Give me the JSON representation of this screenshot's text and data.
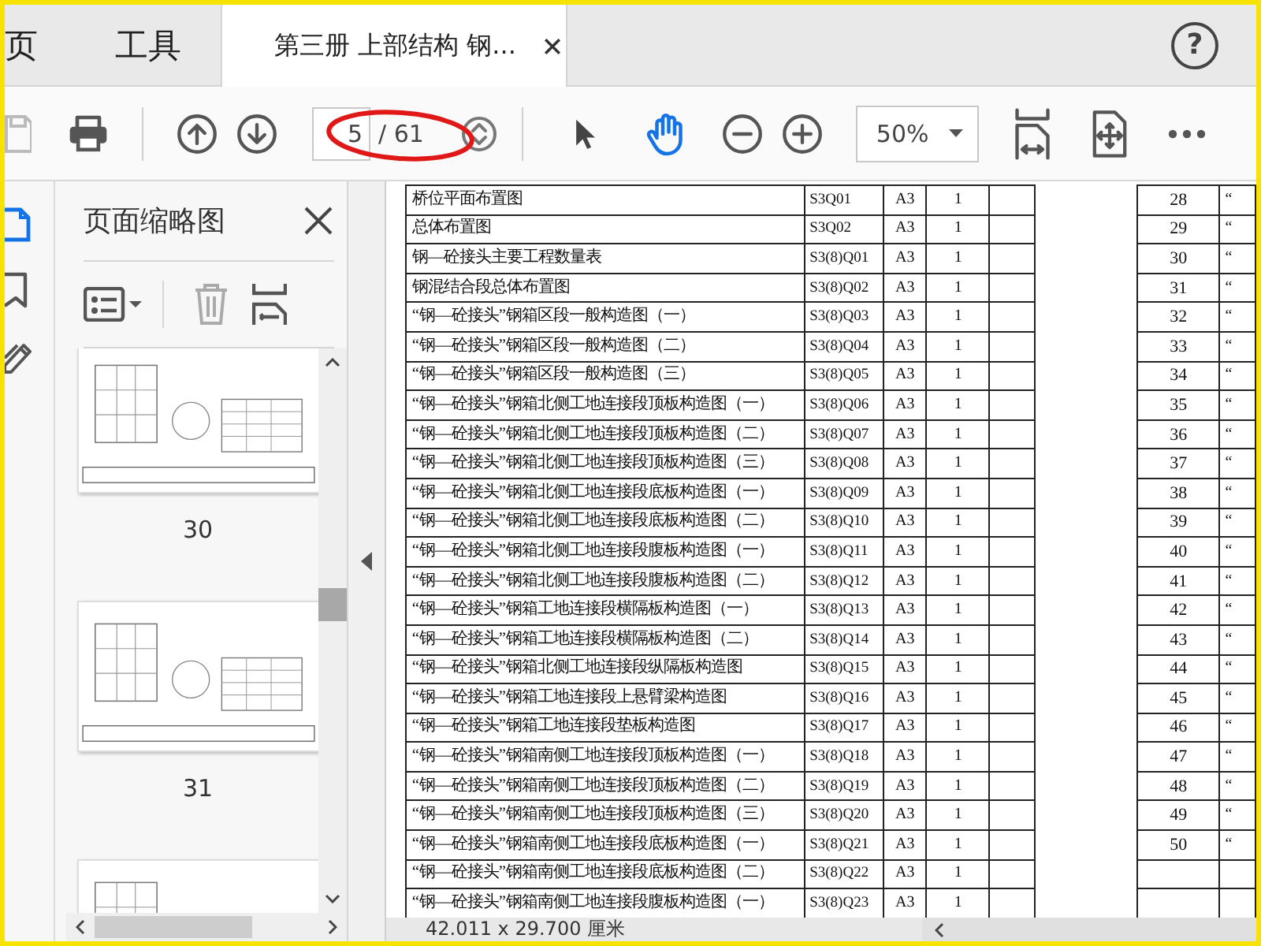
{
  "tabs": [
    {
      "label": "页",
      "selected": false
    },
    {
      "label": "工具",
      "selected": false
    },
    {
      "label": "第三册 上部结构 钢...",
      "selected": true
    }
  ],
  "help_label": "?",
  "toolbar": {
    "page_number": "5",
    "page_total": "/ 61",
    "zoom": "50%",
    "tools": [
      {
        "kind": "select",
        "selected": false
      },
      {
        "kind": "hand",
        "selected": true
      }
    ]
  },
  "side_rail": [
    {
      "kind": "pages",
      "selected": true
    },
    {
      "kind": "bookmarks",
      "selected": false
    },
    {
      "kind": "signatures",
      "selected": false
    }
  ],
  "thumbnail_panel": {
    "title": "页面缩略图",
    "thumbnails": [
      {
        "label": "30",
        "selected": false
      },
      {
        "label": "31",
        "selected": false
      },
      {
        "selected": false
      }
    ]
  },
  "document": {
    "rows": [
      {
        "title": "桥位平面布置图",
        "code": "S3Q01",
        "size": "A3",
        "count": "1",
        "number": "28",
        "column_8": "“"
      },
      {
        "title": "总体布置图",
        "code": "S3Q02",
        "size": "A3",
        "count": "1",
        "number": "29",
        "column_8": "“"
      },
      {
        "title": "钢—砼接头主要工程数量表",
        "code": "S3(8)Q01",
        "size": "A3",
        "count": "1",
        "number": "30",
        "column_8": "“"
      },
      {
        "title": "钢混结合段总体布置图",
        "code": "S3(8)Q02",
        "size": "A3",
        "count": "1",
        "number": "31",
        "column_8": "“"
      },
      {
        "title": "“钢—砼接头”钢箱区段一般构造图（一）",
        "code": "S3(8)Q03",
        "size": "A3",
        "count": "1",
        "number": "32",
        "column_8": "“"
      },
      {
        "title": "“钢—砼接头”钢箱区段一般构造图（二）",
        "code": "S3(8)Q04",
        "size": "A3",
        "count": "1",
        "number": "33",
        "column_8": "“"
      },
      {
        "title": "“钢—砼接头”钢箱区段一般构造图（三）",
        "code": "S3(8)Q05",
        "size": "A3",
        "count": "1",
        "number": "34",
        "column_8": "“"
      },
      {
        "title": "“钢—砼接头”钢箱北侧工地连接段顶板构造图（一）",
        "code": "S3(8)Q06",
        "size": "A3",
        "count": "1",
        "number": "35",
        "column_8": "“"
      },
      {
        "title": "“钢—砼接头”钢箱北侧工地连接段顶板构造图（二）",
        "code": "S3(8)Q07",
        "size": "A3",
        "count": "1",
        "number": "36",
        "column_8": "“"
      },
      {
        "title": "“钢—砼接头”钢箱北侧工地连接段顶板构造图（三）",
        "code": "S3(8)Q08",
        "size": "A3",
        "count": "1",
        "number": "37",
        "column_8": "“"
      },
      {
        "title": "“钢—砼接头”钢箱北侧工地连接段底板构造图（一）",
        "code": "S3(8)Q09",
        "size": "A3",
        "count": "1",
        "number": "38",
        "column_8": "“"
      },
      {
        "title": "“钢—砼接头”钢箱北侧工地连接段底板构造图（二）",
        "code": "S3(8)Q10",
        "size": "A3",
        "count": "1",
        "number": "39",
        "column_8": "“"
      },
      {
        "title": "“钢—砼接头”钢箱北侧工地连接段腹板构造图（一）",
        "code": "S3(8)Q11",
        "size": "A3",
        "count": "1",
        "number": "40",
        "column_8": "“"
      },
      {
        "title": "“钢—砼接头”钢箱北侧工地连接段腹板构造图（二）",
        "code": "S3(8)Q12",
        "size": "A3",
        "count": "1",
        "number": "41",
        "column_8": "“"
      },
      {
        "title": "“钢—砼接头”钢箱工地连接段横隔板构造图（一）",
        "code": "S3(8)Q13",
        "size": "A3",
        "count": "1",
        "number": "42",
        "column_8": "“"
      },
      {
        "title": "“钢—砼接头”钢箱工地连接段横隔板构造图（二）",
        "code": "S3(8)Q14",
        "size": "A3",
        "count": "1",
        "number": "43",
        "column_8": "“"
      },
      {
        "title": "“钢—砼接头”钢箱北侧工地连接段纵隔板构造图",
        "code": "S3(8)Q15",
        "size": "A3",
        "count": "1",
        "number": "44",
        "column_8": "“"
      },
      {
        "title": "“钢—砼接头”钢箱工地连接段上悬臂梁构造图",
        "code": "S3(8)Q16",
        "size": "A3",
        "count": "1",
        "number": "45",
        "column_8": "“"
      },
      {
        "title": "“钢—砼接头”钢箱工地连接段垫板构造图",
        "code": "S3(8)Q17",
        "size": "A3",
        "count": "1",
        "number": "46",
        "column_8": "“"
      },
      {
        "title": "“钢—砼接头”钢箱南侧工地连接段顶板构造图（一）",
        "code": "S3(8)Q18",
        "size": "A3",
        "count": "1",
        "number": "47",
        "column_8": "“"
      },
      {
        "title": "“钢—砼接头”钢箱南侧工地连接段顶板构造图（二）",
        "code": "S3(8)Q19",
        "size": "A3",
        "count": "1",
        "number": "48",
        "column_8": "“"
      },
      {
        "title": "“钢—砼接头”钢箱南侧工地连接段顶板构造图（三）",
        "code": "S3(8)Q20",
        "size": "A3",
        "count": "1",
        "number": "49",
        "column_8": "“"
      },
      {
        "title": "“钢—砼接头”钢箱南侧工地连接段底板构造图（一）",
        "code": "S3(8)Q21",
        "size": "A3",
        "count": "1",
        "number": "50",
        "column_8": "“"
      },
      {
        "title": "“钢—砼接头”钢箱南侧工地连接段底板构造图（二）",
        "code": "S3(8)Q22",
        "size": "A3",
        "count": "1"
      },
      {
        "title": "“钢—砼接头”钢箱南侧工地连接段腹板构造图（一）",
        "code": "S3(8)Q23",
        "size": "A3",
        "count": "1"
      }
    ]
  },
  "status_bar": {
    "page_size": "42.011 x 29.700 厘米"
  }
}
